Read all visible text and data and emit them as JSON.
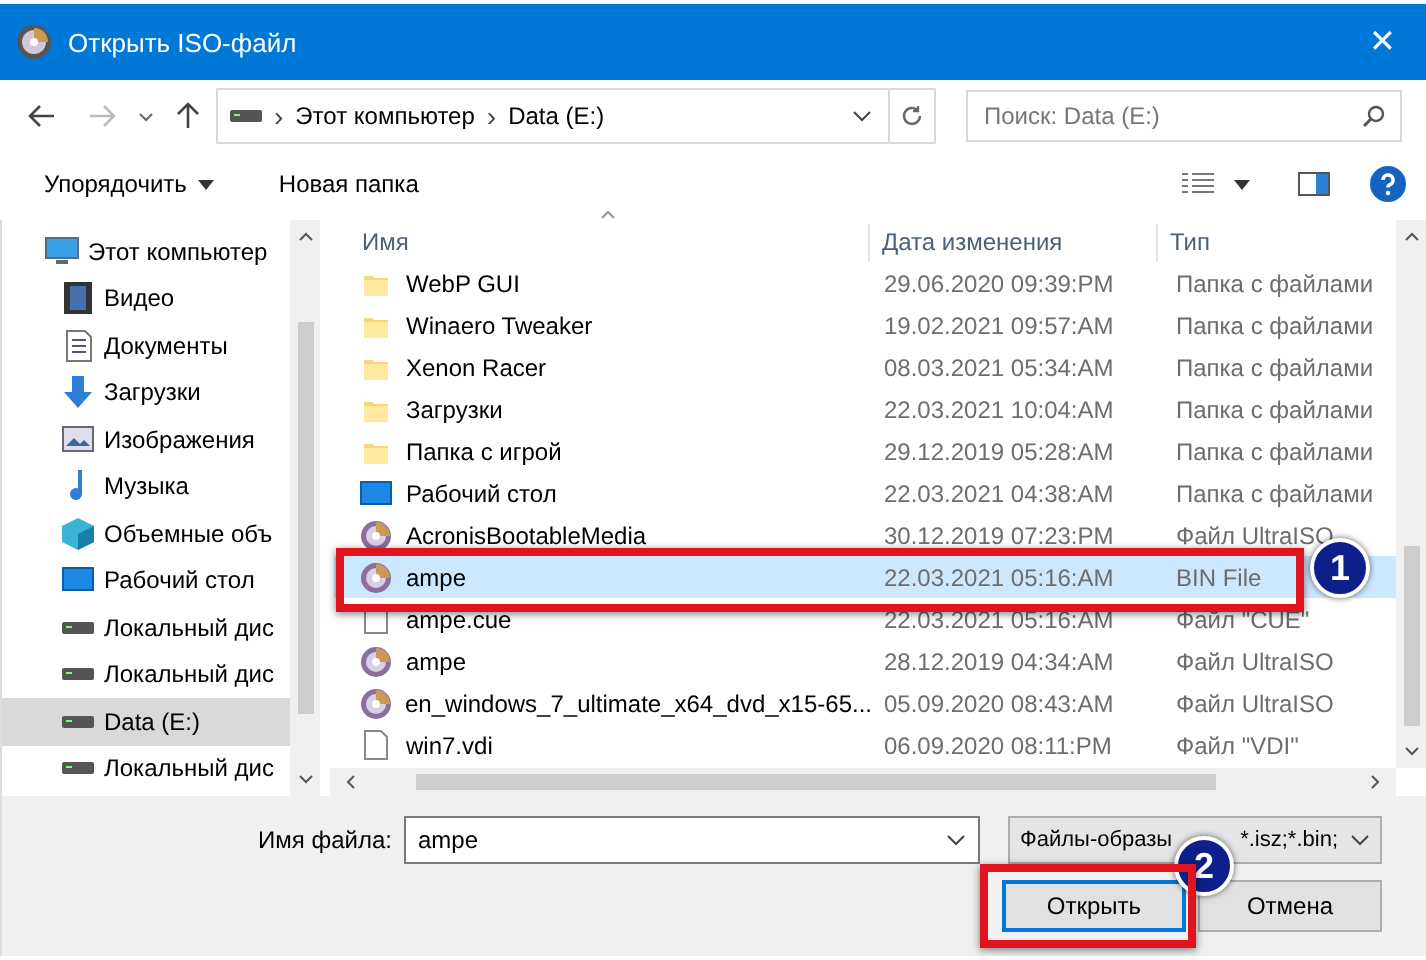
{
  "window": {
    "title": "Открыть ISO-файл",
    "close": "✕"
  },
  "address": {
    "separator": "›",
    "crumbs": [
      "Этот компьютер",
      "Data (E:)"
    ],
    "search_placeholder": "Поиск: Data (E:)"
  },
  "commands": {
    "organize": "Упорядочить",
    "new_folder": "Новая папка"
  },
  "sidebar": {
    "items": [
      {
        "label": "Этот компьютер",
        "kind": "computer",
        "selected": false,
        "children": [
          {
            "label": "Видео",
            "kind": "video",
            "selected": false
          },
          {
            "label": "Документы",
            "kind": "docs",
            "selected": false
          },
          {
            "label": "Загрузки",
            "kind": "download",
            "selected": false
          },
          {
            "label": "Изображения",
            "kind": "images",
            "selected": false
          },
          {
            "label": "Музыка",
            "kind": "music",
            "selected": false
          },
          {
            "label": "Объемные объ",
            "kind": "cube",
            "selected": false
          },
          {
            "label": "Рабочий стол",
            "kind": "desktop",
            "selected": false
          },
          {
            "label": "Локальный дис",
            "kind": "drive",
            "selected": false
          },
          {
            "label": "Локальный дис",
            "kind": "drive",
            "selected": false
          },
          {
            "label": "Data (E:)",
            "kind": "drive",
            "selected": true
          },
          {
            "label": "Локальный дис",
            "kind": "drive",
            "selected": false
          }
        ]
      }
    ]
  },
  "table": {
    "columns": [
      "Имя",
      "Дата изменения",
      "Тип"
    ],
    "rows": [
      {
        "name": "WebP GUI",
        "date": "29.06.2020 09:39:PM",
        "type": "Папка с файлами",
        "kind": "folder",
        "selected": false
      },
      {
        "name": "Winaero Tweaker",
        "date": "19.02.2021 09:57:AM",
        "type": "Папка с файлами",
        "kind": "folder",
        "selected": false
      },
      {
        "name": "Xenon Racer",
        "date": "08.03.2021 05:34:AM",
        "type": "Папка с файлами",
        "kind": "folder",
        "selected": false
      },
      {
        "name": "Загрузки",
        "date": "22.03.2021 10:04:AM",
        "type": "Папка с файлами",
        "kind": "folder",
        "selected": false
      },
      {
        "name": "Папка с игрой",
        "date": "29.12.2019 05:28:AM",
        "type": "Папка с файлами",
        "kind": "folder",
        "selected": false
      },
      {
        "name": "Рабочий стол",
        "date": "22.03.2021 04:38:AM",
        "type": "Папка с файлами",
        "kind": "desktop",
        "selected": false
      },
      {
        "name": "AcronisBootableMedia",
        "date": "30.12.2019 07:23:PM",
        "type": "Файл UltraISO",
        "kind": "disc",
        "selected": false
      },
      {
        "name": "ampe",
        "date": "22.03.2021 05:16:AM",
        "type": "BIN File",
        "kind": "disc",
        "selected": true
      },
      {
        "name": "ampe.cue",
        "date": "22.03.2021 05:16:AM",
        "type": "Файл \"CUE\"",
        "kind": "file",
        "selected": false
      },
      {
        "name": "ampe",
        "date": "28.12.2019 04:34:AM",
        "type": "Файл UltraISO",
        "kind": "disc",
        "selected": false
      },
      {
        "name": "en_windows_7_ultimate_x64_dvd_x15-65...",
        "date": "05.09.2020 08:43:AM",
        "type": "Файл UltraISO",
        "kind": "disc",
        "selected": false
      },
      {
        "name": "win7.vdi",
        "date": "06.09.2020 08:11:PM",
        "type": "Файл \"VDI\"",
        "kind": "file",
        "selected": false
      }
    ]
  },
  "footer": {
    "filename_label": "Имя файла:",
    "filename": "ampe",
    "filter": "Файлы-образы",
    "filter_tail": "*.isz;*.bin;",
    "buttons": [
      "Открыть",
      "Отмена"
    ]
  },
  "annotations": [
    {
      "label": "1"
    },
    {
      "label": "2"
    }
  ]
}
